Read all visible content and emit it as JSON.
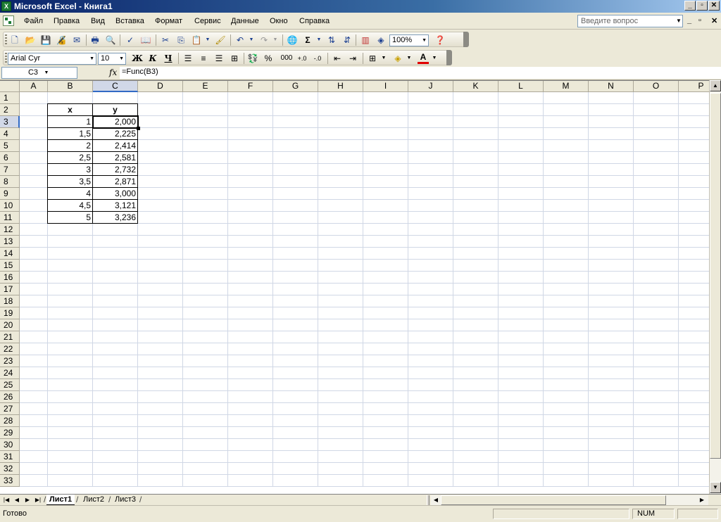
{
  "window": {
    "title": "Microsoft Excel - Книга1",
    "controls": [
      "_",
      "▫",
      "✕"
    ]
  },
  "menu": {
    "items": [
      "Файл",
      "Правка",
      "Вид",
      "Вставка",
      "Формат",
      "Сервис",
      "Данные",
      "Окно",
      "Справка"
    ],
    "ask_placeholder": "Введите вопрос",
    "doc_controls": [
      "_",
      "▫",
      "✕"
    ]
  },
  "toolbar_standard": {
    "zoom": "100%"
  },
  "toolbar_format": {
    "font_name": "Arial Cyr",
    "font_size": "10",
    "bold_label": "Ж",
    "italic_label": "К",
    "underline_label": "Ч",
    "percent_label": "%",
    "thousands_label": "000"
  },
  "formula_bar": {
    "name_box": "C3",
    "fx_label": "fx",
    "formula": "=Func(B3)"
  },
  "grid": {
    "columns": [
      "A",
      "B",
      "C",
      "D",
      "E",
      "F",
      "G",
      "H",
      "I",
      "J",
      "K",
      "L",
      "M",
      "N",
      "O",
      "P"
    ],
    "rows": [
      "1",
      "2",
      "3",
      "4",
      "5",
      "6",
      "7",
      "8",
      "9",
      "10",
      "11",
      "12",
      "13",
      "14",
      "15",
      "16",
      "17",
      "18",
      "19",
      "20",
      "21",
      "22",
      "23",
      "24",
      "25",
      "26",
      "27",
      "28",
      "29",
      "30",
      "31",
      "32",
      "33"
    ],
    "selected_column": "C",
    "selected_row": "3",
    "table": {
      "header_x": "x",
      "header_y": "y",
      "x_values": [
        "1",
        "1,5",
        "2",
        "2,5",
        "3",
        "3,5",
        "4",
        "4,5",
        "5"
      ],
      "y_values": [
        "2,000",
        "2,225",
        "2,414",
        "2,581",
        "2,732",
        "2,871",
        "3,000",
        "3,121",
        "3,236"
      ]
    }
  },
  "sheets": {
    "tabs": [
      "Лист1",
      "Лист2",
      "Лист3"
    ],
    "active": "Лист1"
  },
  "status": {
    "ready": "Готово",
    "num": "NUM"
  }
}
